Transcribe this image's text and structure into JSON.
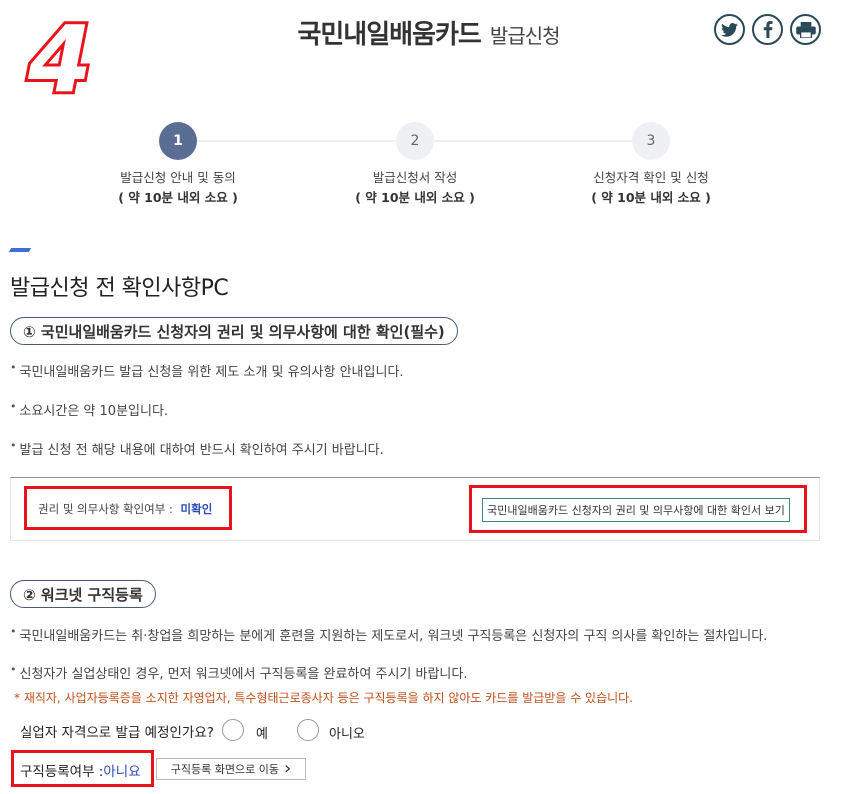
{
  "annotation": {
    "step_number": "4"
  },
  "header": {
    "title": "국민내일배움카드",
    "subtitle": "발급신청",
    "share_icons": [
      "twitter-icon",
      "facebook-icon",
      "print-icon"
    ]
  },
  "stepper": {
    "steps": [
      {
        "number": "1",
        "label": "발급신청 안내 및 동의",
        "time": "( 약 10분 내외 소요 )",
        "active": true
      },
      {
        "number": "2",
        "label": "발급신청서 작성",
        "time": "( 약 10분 내외 소요 )",
        "active": false
      },
      {
        "number": "3",
        "label": "신청자격 확인 및 신청",
        "time": "( 약 10분 내외 소요 )",
        "active": false
      }
    ]
  },
  "section": {
    "title": "발급신청 전 확인사항PC"
  },
  "part1": {
    "heading": "① 국민내일배움카드 신청자의 권리 및 의무사항에 대한 확인(필수)",
    "bullets": [
      "국민내일배움카드 발급 신청을 위한 제도 소개 및 유의사항 안내입니다.",
      "소요시간은 약 10분입니다.",
      "발급 신청 전 해당 내용에 대하여 반드시 확인하여 주시기 바랍니다."
    ],
    "status_label": "권리 및 의무사항 확인여부 :",
    "status_value": "미확인",
    "view_button": "국민내일배움카드 신청자의 권리 및 의무사항에 대한 확인서 보기"
  },
  "part2": {
    "heading": "② 워크넷 구직등록",
    "bullets": [
      "국민내일배움카드는 취·창업을 희망하는 분에게 훈련을 지원하는 제도로서, 워크넷 구직등록은 신청자의 구직 의사를 확인하는 절차입니다.",
      "신청자가 실업상태인 경우, 먼저 워크넷에서 구직등록을 완료하여 주시기 바랍니다."
    ],
    "notice": "* 재직자, 사업자등록증을 소지한 자영업자, 특수형태근로종사자 등은 구직등록을 하지 않아도 카드를 발급받을 수 있습니다.",
    "question": "실업자 자격으로 발급 예정인가요?",
    "option_yes": "예",
    "option_no": "아니오",
    "registration_label": "구직등록여부 :",
    "registration_value": "아니요",
    "goto_button": "구직등록 화면으로 이동",
    "goto_chevron": "›"
  },
  "colors": {
    "accent_blue": "#3d6fd6",
    "step_active": "#5a6e94",
    "annotation_red": "#e8141b",
    "notice_orange": "#c0501c",
    "status_blue": "#2b4bb5"
  }
}
